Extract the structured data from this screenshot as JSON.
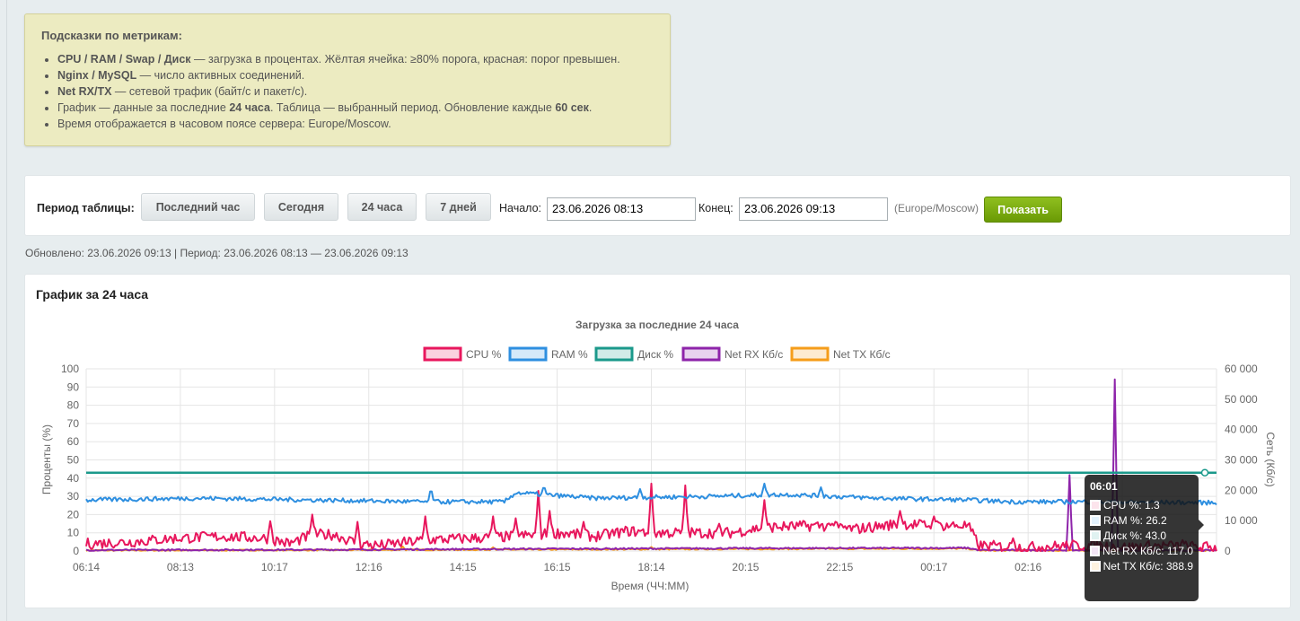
{
  "hints": {
    "title": "Подсказки по метрикам:",
    "items": [
      {
        "bold": "CPU / RAM / Swap / Диск",
        "text": " — загрузка в процентах. Жёлтая ячейка: ≥80% порога, красная: порог превышен."
      },
      {
        "bold": "Nginx / MySQL",
        "text": " — число активных соединений."
      },
      {
        "bold": "Net RX/TX",
        "text": " — сетевой трафик (байт/с и пакет/с)."
      },
      {
        "pre": "График — данные за последние ",
        "bold": "24 часа",
        "text": ". Таблица — выбранный период. Обновление каждые ",
        "bold2": "60 сек",
        "post": "."
      },
      {
        "text": "Время отображается в часовом поясе сервера: Europe/Moscow."
      }
    ]
  },
  "period": {
    "label": "Период таблицы:",
    "buttons": [
      "Последний час",
      "Сегодня",
      "24 часа",
      "7 дней"
    ],
    "start_label": "Начало:",
    "start_value": "23.06.2026 08:13",
    "end_label": "Конец:",
    "end_value": "23.06.2026 09:13",
    "timezone": "(Europe/Moscow)",
    "show_label": "Показать"
  },
  "updated_text": "Обновлено: 23.06.2026 09:13 | Период: 23.06.2026 08:13 — 23.06.2026 09:13",
  "chart_panel": {
    "heading": "График за 24 часа"
  },
  "chart_data": {
    "type": "line",
    "title": "Загрузка за последние 24 часа",
    "xlabel": "Время (ЧЧ:ММ)",
    "ylabel": "Проценты (%)",
    "y2label": "Сеть (Кб/с)",
    "ylim": [
      0,
      100
    ],
    "y2lim": [
      0,
      60000
    ],
    "yticks": [
      "0",
      "10",
      "20",
      "30",
      "40",
      "50",
      "60",
      "70",
      "80",
      "90",
      "100"
    ],
    "y2ticks": [
      "0",
      "10 000",
      "20 000",
      "30 000",
      "40 000",
      "50 000",
      "60 000"
    ],
    "x_tick_labels": [
      "06:14",
      "08:13",
      "10:17",
      "12:16",
      "14:15",
      "16:15",
      "18:14",
      "20:15",
      "22:15",
      "00:17",
      "02:16"
    ],
    "legend_position": "top",
    "grid": true,
    "series": [
      {
        "name": "CPU %",
        "color": "#e8175d",
        "axis": "left",
        "baseline": [
          [
            0,
            4
          ],
          [
            4,
            5
          ],
          [
            8,
            7
          ],
          [
            12,
            8
          ],
          [
            16,
            7
          ],
          [
            18,
            4
          ],
          [
            20,
            9
          ],
          [
            22,
            9
          ],
          [
            24,
            4
          ],
          [
            26,
            3
          ],
          [
            30,
            6
          ],
          [
            34,
            7
          ],
          [
            38,
            8
          ],
          [
            42,
            10
          ],
          [
            45,
            8
          ],
          [
            48,
            11
          ],
          [
            50,
            10
          ],
          [
            54,
            10
          ],
          [
            57,
            10
          ],
          [
            60,
            13
          ],
          [
            65,
            14
          ],
          [
            68,
            12
          ],
          [
            72,
            15
          ],
          [
            75,
            14
          ],
          [
            78,
            14
          ],
          [
            79,
            3
          ],
          [
            83,
            2
          ],
          [
            87,
            3
          ],
          [
            90,
            3
          ],
          [
            92,
            2
          ],
          [
            95,
            3
          ],
          [
            100,
            2
          ]
        ],
        "spikes": [
          [
            16.3,
            17
          ],
          [
            20,
            20
          ],
          [
            24,
            16
          ],
          [
            30,
            19
          ],
          [
            36,
            19
          ],
          [
            38,
            18
          ],
          [
            40,
            33
          ],
          [
            41,
            22
          ],
          [
            44,
            16
          ],
          [
            50,
            37
          ],
          [
            53,
            36
          ],
          [
            56,
            15
          ],
          [
            60,
            28
          ],
          [
            66,
            15
          ],
          [
            72,
            22
          ],
          [
            75,
            19
          ],
          [
            82,
            7
          ],
          [
            97,
            6
          ]
        ]
      },
      {
        "name": "RAM %",
        "color": "#2e8fe0",
        "axis": "left",
        "baseline": [
          [
            0,
            28
          ],
          [
            10,
            29
          ],
          [
            20,
            28
          ],
          [
            30,
            27
          ],
          [
            37,
            27
          ],
          [
            38,
            32
          ],
          [
            45,
            29
          ],
          [
            55,
            30
          ],
          [
            62,
            31
          ],
          [
            70,
            29
          ],
          [
            78,
            28
          ],
          [
            82,
            27
          ],
          [
            88,
            27
          ],
          [
            100,
            26.5
          ]
        ],
        "spikes": [
          [
            30.5,
            35
          ],
          [
            40.5,
            36
          ],
          [
            49,
            34
          ],
          [
            60,
            37
          ],
          [
            65,
            35
          ]
        ]
      },
      {
        "name": "Диск %",
        "color": "#1b998b",
        "axis": "left",
        "baseline": [
          [
            0,
            43
          ],
          [
            100,
            43
          ]
        ],
        "spikes": []
      },
      {
        "name": "Net RX Кб/с",
        "color": "#8e24aa",
        "axis": "right",
        "baseline": [
          [
            0,
            300
          ],
          [
            20,
            400
          ],
          [
            40,
            700
          ],
          [
            60,
            900
          ],
          [
            78,
            1000
          ],
          [
            79,
            300
          ],
          [
            100,
            200
          ]
        ],
        "spikes": [
          [
            87,
            25000
          ],
          [
            91,
            56500
          ]
        ]
      },
      {
        "name": "Net TX Кб/с",
        "color": "#f59d1a",
        "axis": "right",
        "baseline": [
          [
            0,
            200
          ],
          [
            20,
            300
          ],
          [
            40,
            500
          ],
          [
            60,
            700
          ],
          [
            78,
            800
          ],
          [
            79,
            200
          ],
          [
            100,
            150
          ]
        ],
        "spikes": [
          [
            28,
            1500
          ],
          [
            36,
            1200
          ],
          [
            50,
            1300
          ]
        ]
      }
    ]
  },
  "tooltip": {
    "time": "06:01",
    "rows": [
      {
        "label": "CPU %: 1.3",
        "color": "#fce4ec"
      },
      {
        "label": "RAM %: 26.2",
        "color": "#e3f2fd"
      },
      {
        "label": "Диск %: 43.0",
        "color": "#e0f2f1"
      },
      {
        "label": "Net RX Кб/с: 117.0",
        "color": "#f3e5f5"
      },
      {
        "label": "Net TX Кб/с: 388.9",
        "color": "#fff3e0"
      }
    ]
  }
}
